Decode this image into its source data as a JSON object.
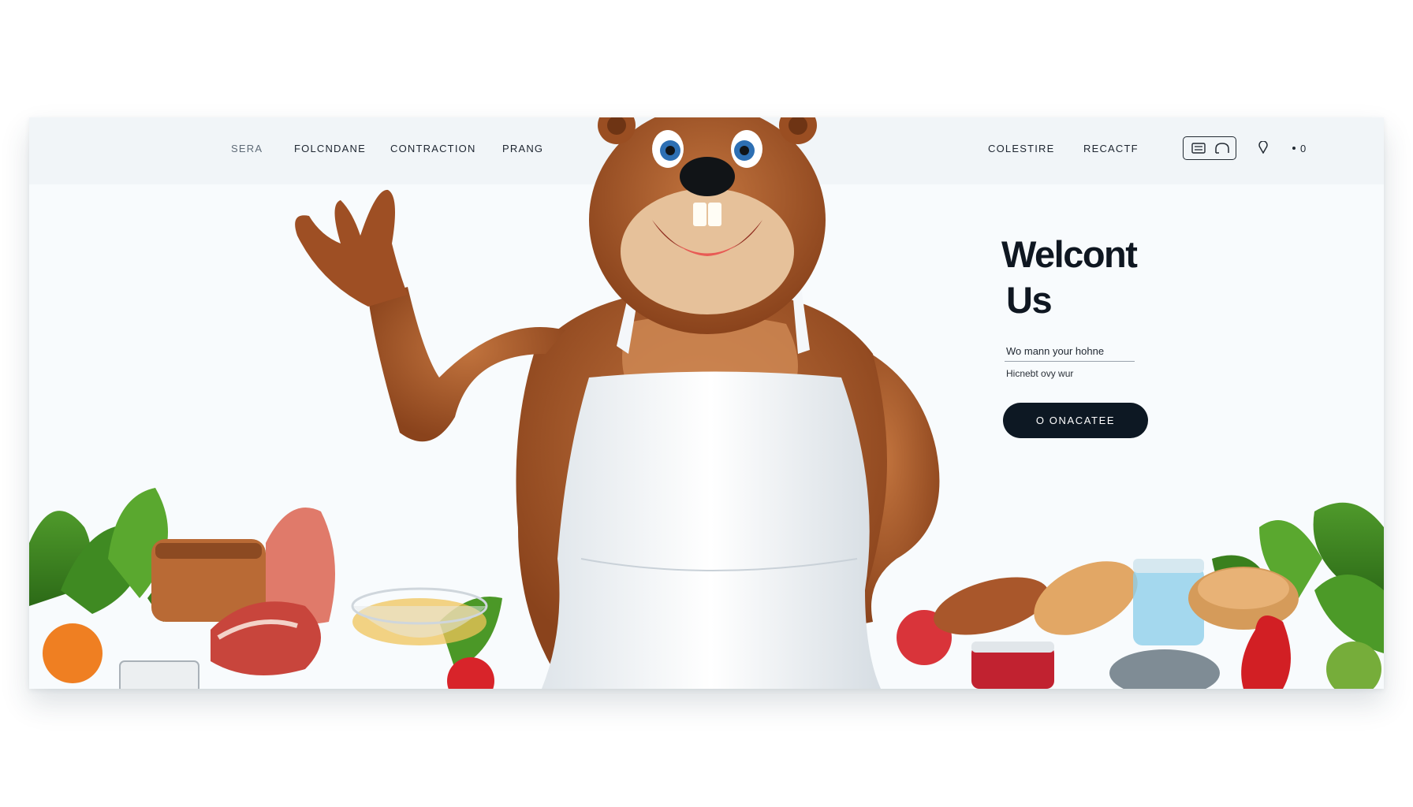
{
  "nav": {
    "left_links": [
      "SERA",
      "FOLCNDANE",
      "CONTRACTION",
      "PRANG"
    ],
    "right_links": [
      "COLESTIRE",
      "RECACTF"
    ],
    "counter": "0"
  },
  "hero": {
    "title_line1": "Welcont",
    "title_line2": "Us",
    "field1_value": "Wo mann your hohne",
    "field2_text": "Hicnebt ovy wur",
    "cta_label": "O ONACATEE"
  },
  "colors": {
    "card_bg": "#f8fbfd",
    "nav_bg": "#f1f5f8",
    "button_bg": "#0d1823",
    "fur": "#a4582a"
  },
  "icons": [
    "menu-icon",
    "headphones-icon",
    "location-pin-icon",
    "dot-icon"
  ]
}
